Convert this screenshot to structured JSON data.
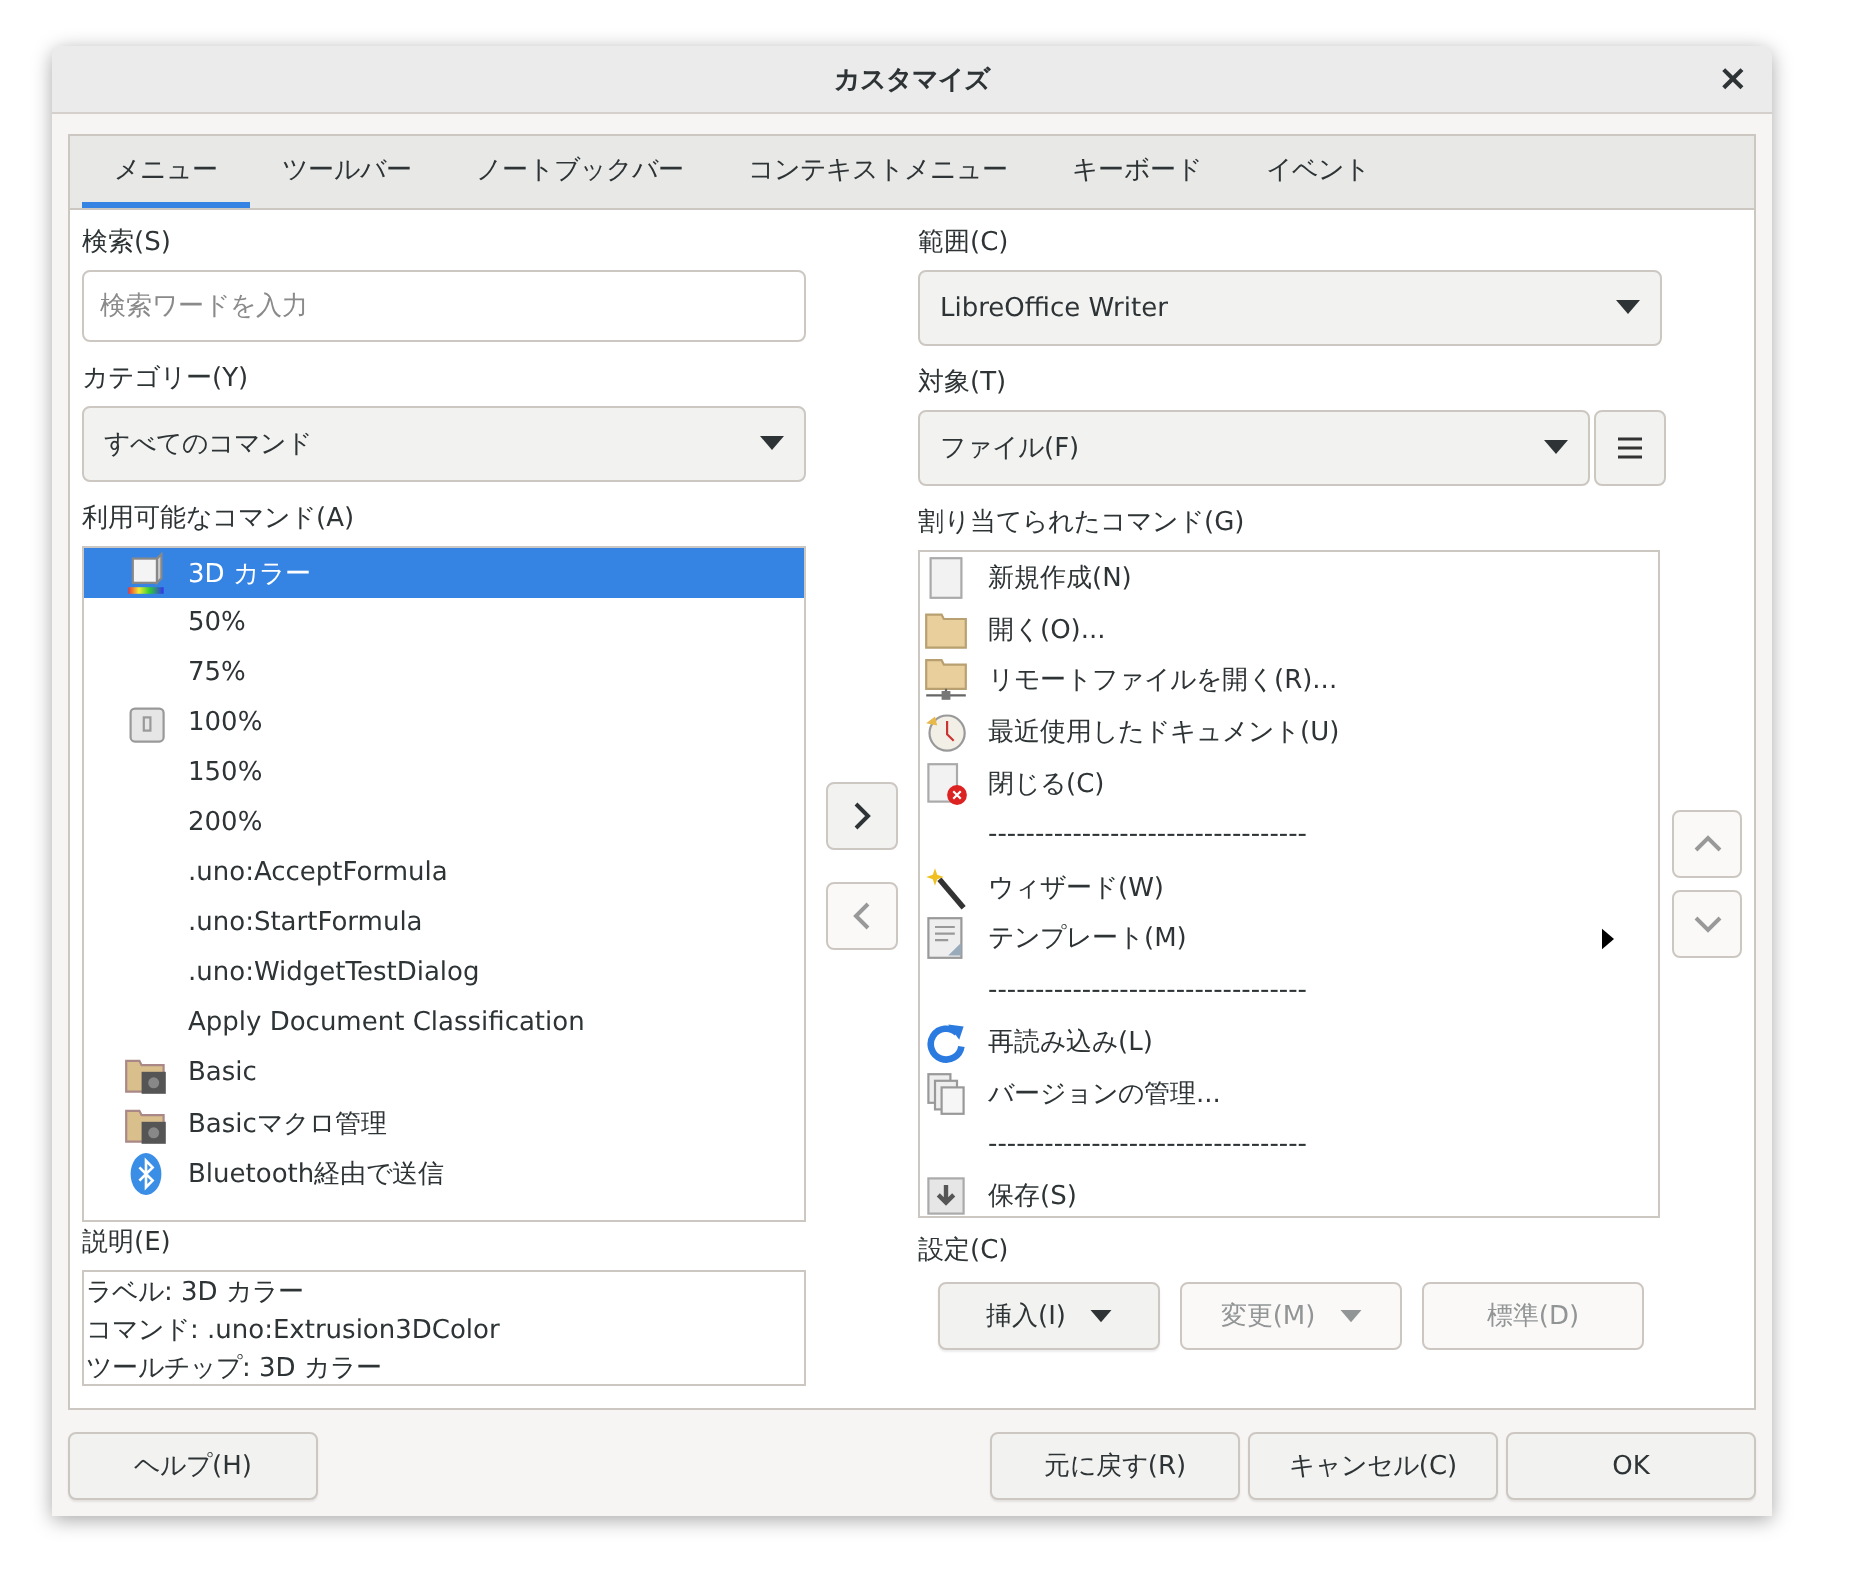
{
  "window": {
    "title": "カスタマイズ",
    "close": "×"
  },
  "tabs": [
    {
      "label": "メニュー",
      "selected": true
    },
    {
      "label": "ツールバー",
      "selected": false
    },
    {
      "label": "ノートブックバー",
      "selected": false
    },
    {
      "label": "コンテキストメニュー",
      "selected": false
    },
    {
      "label": "キーボード",
      "selected": false
    },
    {
      "label": "イベント",
      "selected": false
    }
  ],
  "search": {
    "label": "検索(S)",
    "placeholder": "検索ワードを入力"
  },
  "category": {
    "label": "カテゴリー(Y)",
    "value": "すべてのコマンド"
  },
  "available": {
    "label": "利用可能なコマンド(A)",
    "items": [
      {
        "text": "3D カラー",
        "kind": "cube",
        "selected": true
      },
      {
        "text": "50%",
        "kind": "plain",
        "selected": false
      },
      {
        "text": "75%",
        "kind": "plain",
        "selected": false
      },
      {
        "text": "100%",
        "kind": "key",
        "selected": false
      },
      {
        "text": "150%",
        "kind": "plain",
        "selected": false
      },
      {
        "text": "200%",
        "kind": "plain",
        "selected": false
      },
      {
        "text": ".uno:AcceptFormula",
        "kind": "plain",
        "selected": false
      },
      {
        "text": ".uno:StartFormula",
        "kind": "plain",
        "selected": false
      },
      {
        "text": ".uno:WidgetTestDialog",
        "kind": "plain",
        "selected": false
      },
      {
        "text": "Apply Document Classification",
        "kind": "plain",
        "selected": false
      },
      {
        "text": "Basic",
        "kind": "folder-gear",
        "selected": false
      },
      {
        "text": "Basicマクロ管理",
        "kind": "folder-gear",
        "selected": false
      },
      {
        "text": "Bluetooth経由で送信",
        "kind": "bluetooth",
        "selected": false
      }
    ]
  },
  "description": {
    "label": "説明(E)",
    "lines": [
      "ラベル: 3D カラー",
      "コマンド: .uno:Extrusion3DColor",
      "ツールチップ: 3D カラー"
    ]
  },
  "scope": {
    "label": "範囲(C)",
    "value": "LibreOffice Writer"
  },
  "target": {
    "label": "対象(T)",
    "value": "ファイル(F)"
  },
  "assigned": {
    "label": "割り当てられたコマンド(G)",
    "items": [
      {
        "kind": "page",
        "text": "新規作成(N)",
        "has_submenu": false
      },
      {
        "kind": "folder",
        "text": "開く(O)...",
        "has_submenu": false
      },
      {
        "kind": "remote-folder",
        "text": "リモートファイルを開く(R)...",
        "has_submenu": false
      },
      {
        "kind": "clock",
        "text": "最近使用したドキュメント(U)",
        "has_submenu": false
      },
      {
        "kind": "close-doc",
        "text": "閉じる(C)",
        "has_submenu": false
      },
      {
        "kind": "separator",
        "text": "----------------------------------"
      },
      {
        "kind": "wand",
        "text": "ウィザード(W)",
        "has_submenu": false
      },
      {
        "kind": "template",
        "text": "テンプレート(M)",
        "has_submenu": true
      },
      {
        "kind": "separator",
        "text": "----------------------------------"
      },
      {
        "kind": "reload",
        "text": "再読み込み(L)",
        "has_submenu": false
      },
      {
        "kind": "versions",
        "text": "バージョンの管理...",
        "has_submenu": false
      },
      {
        "kind": "separator",
        "text": "----------------------------------"
      },
      {
        "kind": "save",
        "text": "保存(S)",
        "has_submenu": false
      }
    ]
  },
  "move_buttons": [
    {
      "disabled": false
    },
    {
      "disabled": true
    }
  ],
  "order_buttons": [
    {
      "disabled": true
    },
    {
      "disabled": true
    }
  ],
  "settings": {
    "label": "設定(C)",
    "buttons": [
      {
        "label": "挿入(I)",
        "dropdown": true,
        "disabled": false
      },
      {
        "label": "変更(M)",
        "dropdown": true,
        "disabled": true
      },
      {
        "label": "標準(D)",
        "dropdown": false,
        "disabled": true
      }
    ]
  },
  "footer": {
    "help": "ヘルプ(H)",
    "buttons": [
      "元に戻す(R)",
      "キャンセル(C)",
      "OK"
    ]
  }
}
